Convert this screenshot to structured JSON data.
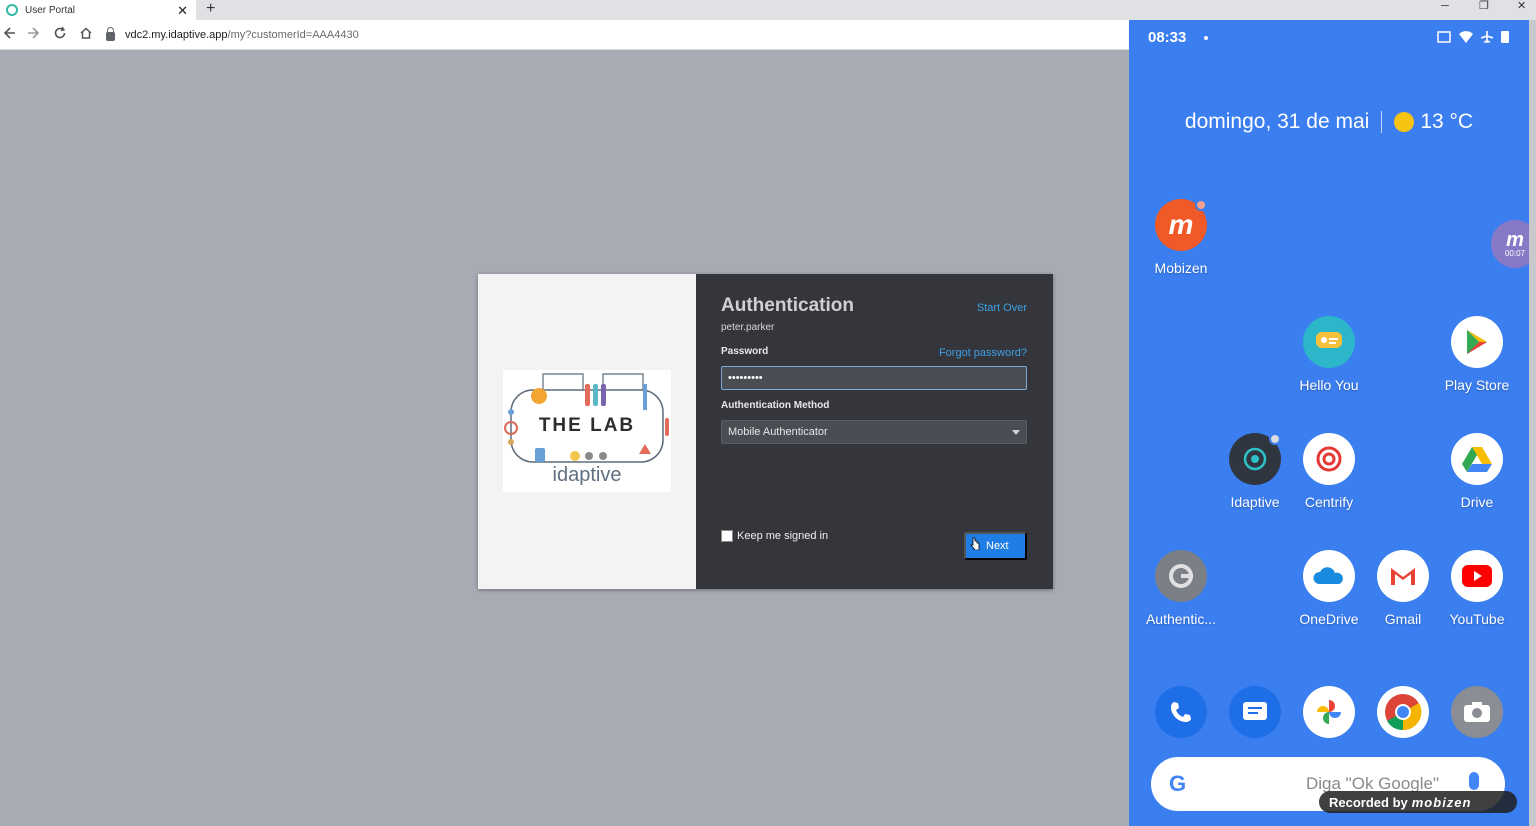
{
  "browser": {
    "tab_title": "User Portal",
    "tab_close": "✕",
    "new_tab": "+",
    "url_host": "vdc2.my.idaptive.app",
    "url_path": "/my?customerId=AAA4430",
    "win_min": "─",
    "win_restore": "❐",
    "win_close": "✕"
  },
  "login": {
    "title": "Authentication",
    "start_over": "Start Over",
    "username": "peter.parker",
    "password_label": "Password",
    "forgot_password": "Forgot password?",
    "password_value": "•••••••••",
    "method_label": "Authentication Method",
    "method_value": "Mobile Authenticator",
    "keep_signed_in": "Keep me signed in",
    "next": "Next",
    "logo_title": "THE LAB",
    "logo_brand": "idaptive"
  },
  "phone": {
    "time": "08:33",
    "date": "domingo, 31 de mai",
    "temperature": "13 °C",
    "floating_badge_time": "00:07",
    "apps": [
      {
        "label": "Mobizen",
        "icon": "mobizen-icon"
      },
      {
        "label": "Hello You",
        "icon": "hello-you-icon"
      },
      {
        "label": "Play Store",
        "icon": "play-store-icon"
      },
      {
        "label": "Idaptive",
        "icon": "idaptive-icon"
      },
      {
        "label": "Centrify",
        "icon": "centrify-icon"
      },
      {
        "label": "Drive",
        "icon": "drive-icon"
      },
      {
        "label": "Authentic...",
        "icon": "authenticator-icon"
      },
      {
        "label": "OneDrive",
        "icon": "onedrive-icon"
      },
      {
        "label": "Gmail",
        "icon": "gmail-icon"
      },
      {
        "label": "YouTube",
        "icon": "youtube-icon"
      }
    ],
    "dock": [
      "phone-icon",
      "messages-icon",
      "photos-icon",
      "chrome-icon",
      "camera-icon"
    ],
    "search_placeholder": "Diga \"Ok Google\"",
    "search_g": "G",
    "recorded_by": "Recorded by",
    "recorded_brand": "mobizen"
  },
  "colors": {
    "accent": "#1f7ee6",
    "link": "#3e9fe6",
    "panel": "#34363b",
    "phone_bg": "#3a7ef0"
  }
}
